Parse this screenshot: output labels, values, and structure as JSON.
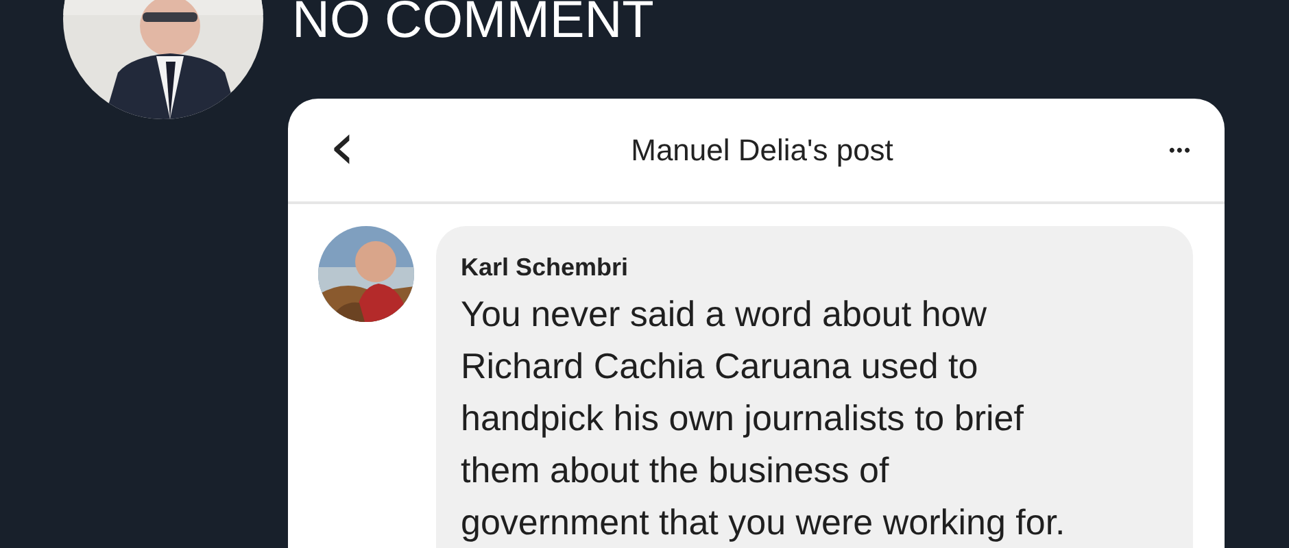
{
  "headline": "NO COMMENT",
  "post": {
    "title": "Manuel Delia's post",
    "back": "‹",
    "more": "•••",
    "comment": {
      "author": "Karl Schembri",
      "lines": [
        "You never said a word about how",
        "Richard Cachia Caruana used to",
        "handpick his own journalists to brief",
        "them about the business of",
        "government that you were working for."
      ]
    }
  }
}
